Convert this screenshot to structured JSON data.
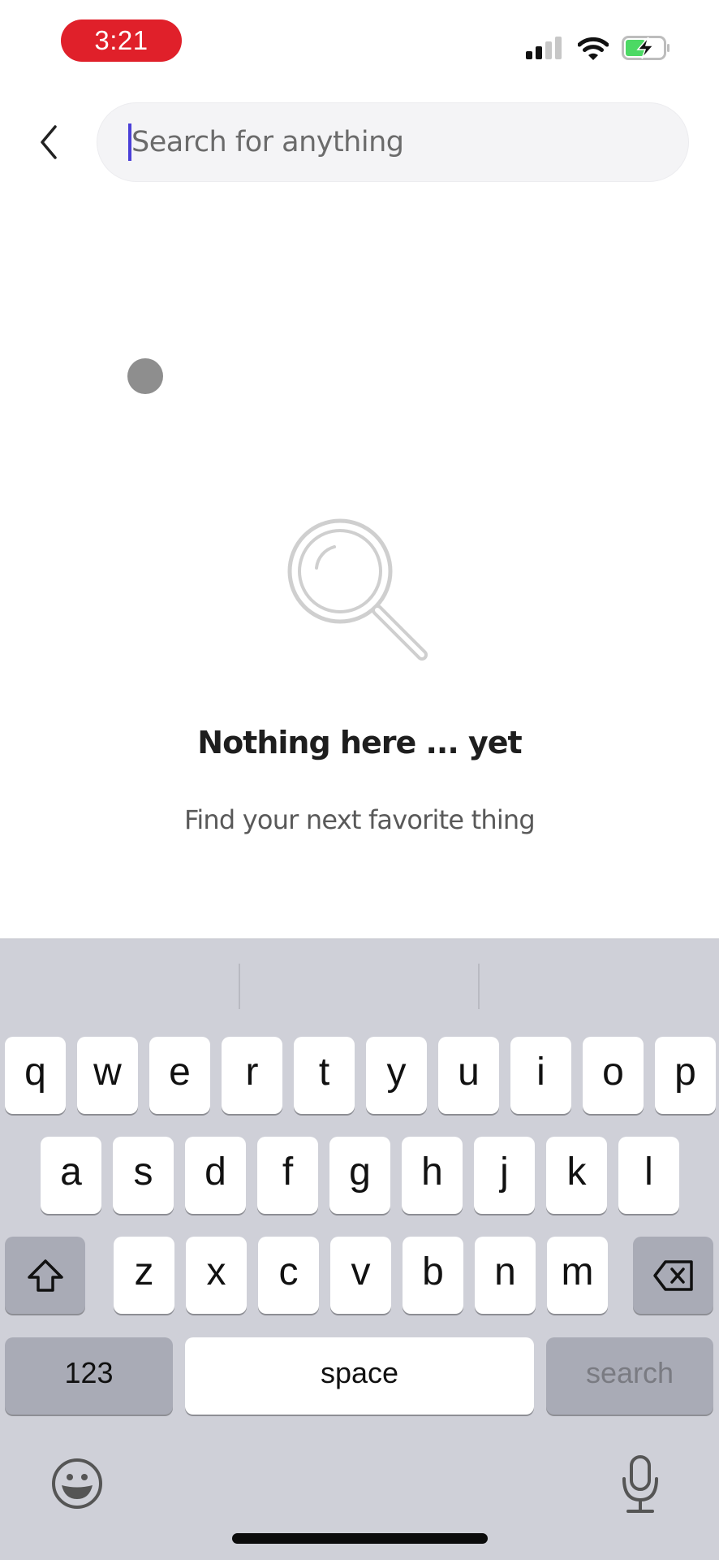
{
  "status_bar": {
    "time": "3:21",
    "time_pill_color": "#e0202a",
    "icons": [
      "cellular-signal-icon",
      "wifi-icon",
      "battery-charging-icon"
    ]
  },
  "header": {
    "back_icon": "chevron-left-icon",
    "search": {
      "value": "",
      "placeholder": "Search for anything",
      "caret_color": "#4b3fd8"
    }
  },
  "empty_state": {
    "icon": "magnifying-glass-icon",
    "title": "Nothing here ... yet",
    "subtitle": "Find your next favorite thing"
  },
  "keyboard": {
    "rows": [
      [
        "q",
        "w",
        "e",
        "r",
        "t",
        "y",
        "u",
        "i",
        "o",
        "p"
      ],
      [
        "a",
        "s",
        "d",
        "f",
        "g",
        "h",
        "j",
        "k",
        "l"
      ],
      [
        "z",
        "x",
        "c",
        "v",
        "b",
        "n",
        "m"
      ]
    ],
    "shift_icon": "shift-icon",
    "delete_icon": "backspace-icon",
    "numbers_label": "123",
    "space_label": "space",
    "return_label": "search",
    "emoji_icon": "emoji-icon",
    "mic_icon": "microphone-icon"
  }
}
